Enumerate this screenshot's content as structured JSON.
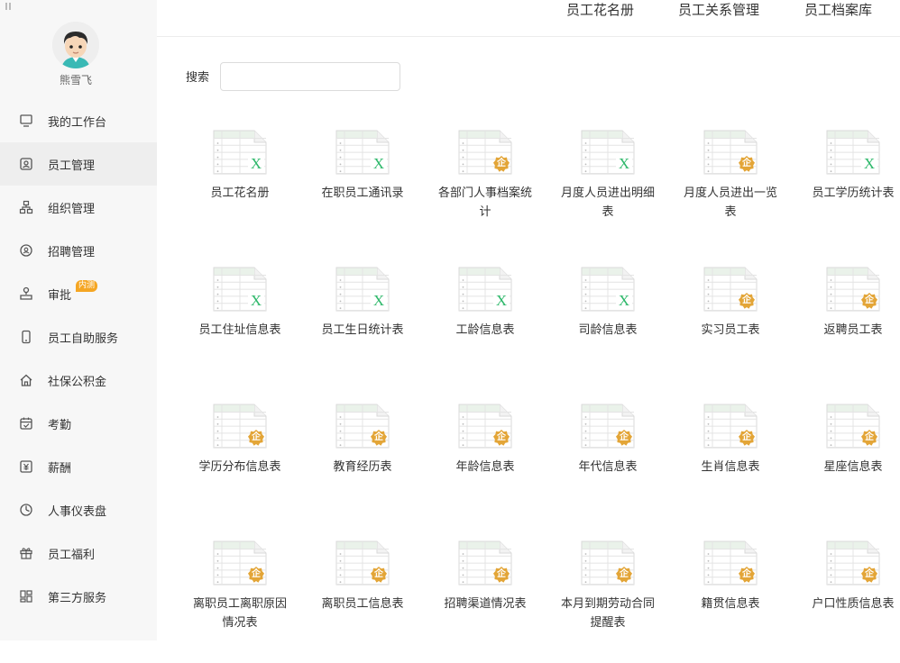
{
  "user": {
    "name": "熊雪飞"
  },
  "nav": {
    "items": [
      {
        "label": "我的工作台",
        "icon": "monitor-icon",
        "active": false
      },
      {
        "label": "员工管理",
        "icon": "user-card-icon",
        "active": true
      },
      {
        "label": "组织管理",
        "icon": "org-chart-icon",
        "active": false
      },
      {
        "label": "招聘管理",
        "icon": "search-user-icon",
        "active": false
      },
      {
        "label": "审批",
        "icon": "stamp-icon",
        "active": false,
        "badge": "内测"
      },
      {
        "label": "员工自助服务",
        "icon": "phone-icon",
        "active": false
      },
      {
        "label": "社保公积金",
        "icon": "house-icon",
        "active": false
      },
      {
        "label": "考勤",
        "icon": "calendar-icon",
        "active": false
      },
      {
        "label": "薪酬",
        "icon": "salary-icon",
        "active": false
      },
      {
        "label": "人事仪表盘",
        "icon": "dashboard-icon",
        "active": false
      },
      {
        "label": "员工福利",
        "icon": "gift-icon",
        "active": false
      },
      {
        "label": "第三方服务",
        "icon": "apps-icon",
        "active": false
      }
    ]
  },
  "tabs": [
    {
      "label": "员工花名册"
    },
    {
      "label": "员工关系管理"
    },
    {
      "label": "员工档案库"
    }
  ],
  "search": {
    "label": "搜索",
    "value": "",
    "placeholder": ""
  },
  "colors": {
    "excel": "#2fb86b",
    "enterprise": "#e3a537",
    "sheet_border": "#d9d9d9",
    "sheet_header": "#eaf2ea"
  },
  "reports": [
    {
      "name": "员工花名册",
      "type": "excel"
    },
    {
      "name": "在职员工通讯录",
      "type": "excel"
    },
    {
      "name": "各部门人事档案统计",
      "type": "enterprise"
    },
    {
      "name": "月度人员进出明细表",
      "type": "excel"
    },
    {
      "name": "月度人员进出一览表",
      "type": "enterprise"
    },
    {
      "name": "员工学历统计表",
      "type": "excel"
    },
    {
      "name": "员工住址信息表",
      "type": "excel"
    },
    {
      "name": "员工生日统计表",
      "type": "excel"
    },
    {
      "name": "工龄信息表",
      "type": "excel"
    },
    {
      "name": "司龄信息表",
      "type": "excel"
    },
    {
      "name": "实习员工表",
      "type": "enterprise"
    },
    {
      "name": "返聘员工表",
      "type": "enterprise"
    },
    {
      "name": "学历分布信息表",
      "type": "enterprise"
    },
    {
      "name": "教育经历表",
      "type": "enterprise"
    },
    {
      "name": "年龄信息表",
      "type": "enterprise"
    },
    {
      "name": "年代信息表",
      "type": "enterprise"
    },
    {
      "name": "生肖信息表",
      "type": "enterprise"
    },
    {
      "name": "星座信息表",
      "type": "enterprise"
    },
    {
      "name": "离职员工离职原因情况表",
      "type": "enterprise"
    },
    {
      "name": "离职员工信息表",
      "type": "enterprise"
    },
    {
      "name": "招聘渠道情况表",
      "type": "enterprise"
    },
    {
      "name": "本月到期劳动合同提醒表",
      "type": "enterprise"
    },
    {
      "name": "籍贯信息表",
      "type": "enterprise"
    },
    {
      "name": "户口性质信息表",
      "type": "enterprise"
    }
  ],
  "badge_glyphs": {
    "excel": "X",
    "enterprise": "企"
  }
}
